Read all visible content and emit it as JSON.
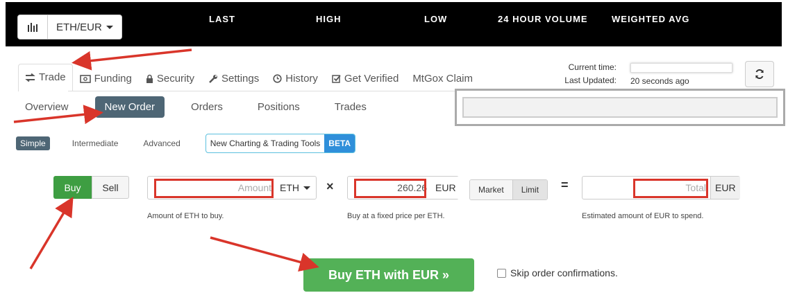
{
  "header": {
    "pair_label": "ETH/EUR",
    "stats": [
      "LAST",
      "HIGH",
      "LOW",
      "24 HOUR VOLUME",
      "WEIGHTED AVG"
    ]
  },
  "tabs": [
    "Trade",
    "Funding",
    "Security",
    "Settings",
    "History",
    "Get Verified",
    "MtGox Claim"
  ],
  "status": {
    "current_time_label": "Current time:",
    "last_updated_label": "Last Updated:",
    "last_updated_value": "20 seconds ago"
  },
  "subtabs": [
    "Overview",
    "New Order",
    "Orders",
    "Positions",
    "Trades"
  ],
  "modes": [
    "Simple",
    "Intermediate",
    "Advanced"
  ],
  "beta": {
    "label": "New Charting & Trading Tools",
    "badge": "BETA"
  },
  "order": {
    "buy_label": "Buy",
    "sell_label": "Sell",
    "amount_placeholder": "Amount",
    "amount_unit": "ETH",
    "price_value": "260.26",
    "price_unit": "EUR",
    "market_label": "Market",
    "limit_label": "Limit",
    "total_placeholder": "Total",
    "total_unit": "EUR",
    "multiply": "×",
    "equals": "=",
    "amount_hint": "Amount of ETH to buy.",
    "price_hint": "Buy at a fixed price per ETH.",
    "total_hint": "Estimated amount of EUR to spend.",
    "submit_label": "Buy ETH with EUR »",
    "skip_label": "Skip order confirmations."
  },
  "colors": {
    "header_bg": "#000000",
    "buy_green": "#3e9e42",
    "active_tab": "#4e6675",
    "annotation_red": "#d9352a",
    "beta_blue": "#2f8fda"
  }
}
